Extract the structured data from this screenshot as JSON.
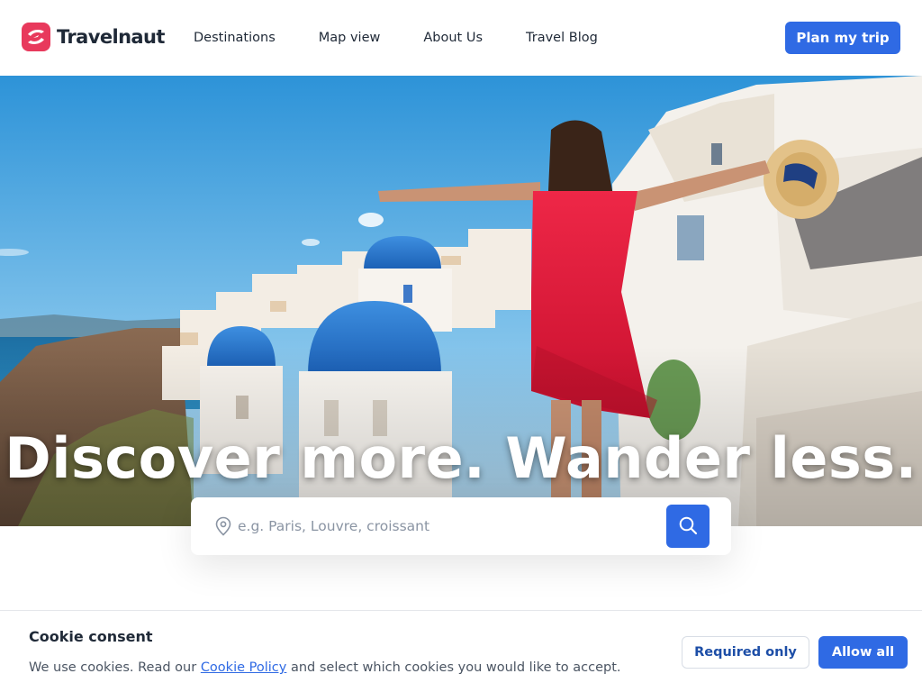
{
  "brand": {
    "name": "Travelnaut",
    "accent": "#2f6ae4",
    "logo_color": "#e8395c"
  },
  "nav": {
    "items": [
      {
        "label": "Destinations"
      },
      {
        "label": "Map view"
      },
      {
        "label": "About Us"
      },
      {
        "label": "Travel Blog"
      }
    ],
    "cta_label": "Plan my trip"
  },
  "hero": {
    "headline": "Discover more. Wander less.",
    "image_alt": "Woman in red dress with arms outstretched overlooking white buildings and blue domes"
  },
  "search": {
    "placeholder": "e.g. Paris, Louvre, croissant",
    "value": "",
    "pin_icon": "map-pin-icon",
    "button_icon": "search-icon"
  },
  "cookie": {
    "title": "Cookie consent",
    "text_before": "We use cookies. Read our ",
    "link_label": "Cookie Policy",
    "text_after": " and select which cookies you would like to accept.",
    "required_label": "Required only",
    "allow_label": "Allow all"
  }
}
